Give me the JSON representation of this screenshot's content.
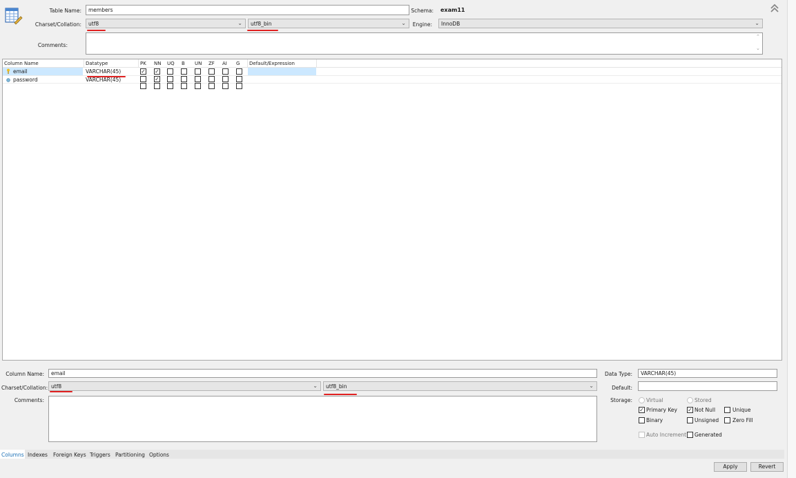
{
  "table": {
    "name_label": "Table Name:",
    "name_value": "members",
    "schema_label": "Schema:",
    "schema_value": "exam11",
    "charset_label": "Charset/Collation:",
    "charset_value": "utf8",
    "collation_value": "utf8_bin",
    "engine_label": "Engine:",
    "engine_value": "InnoDB",
    "comments_label": "Comments:",
    "comments_value": ""
  },
  "grid": {
    "headers": [
      "Column Name",
      "Datatype",
      "PK",
      "NN",
      "UQ",
      "B",
      "UN",
      "ZF",
      "AI",
      "G",
      "Default/Expression"
    ],
    "rows": [
      {
        "icon": "key-icon",
        "name": "email",
        "datatype": "VARCHAR(45)",
        "flags": [
          true,
          true,
          false,
          false,
          false,
          false,
          false,
          false
        ],
        "default": ""
      },
      {
        "icon": "diamond-icon",
        "name": "password",
        "datatype": "VARCHAR(45)",
        "flags": [
          false,
          true,
          false,
          false,
          false,
          false,
          false,
          false
        ],
        "default": ""
      },
      {
        "icon": "",
        "name": "",
        "datatype": "",
        "flags": [
          false,
          false,
          false,
          false,
          false,
          false,
          false,
          false
        ],
        "default": ""
      }
    ]
  },
  "detail": {
    "column_name_label": "Column Name:",
    "column_name_value": "email",
    "charset_label": "Charset/Collation:",
    "charset_value": "utf8",
    "collation_value": "utf8_bin",
    "comments_label": "Comments:",
    "comments_value": "",
    "data_type_label": "Data Type:",
    "data_type_value": "VARCHAR(45)",
    "default_label": "Default:",
    "default_value": "",
    "storage_label": "Storage:",
    "virtual_label": "Virtual",
    "stored_label": "Stored",
    "primary_key_label": "Primary Key",
    "not_null_label": "Not Null",
    "unique_label": "Unique",
    "binary_label": "Binary",
    "unsigned_label": "Unsigned",
    "zero_fill_label": "Zero Fill",
    "auto_increment_label": "Auto Increment",
    "generated_label": "Generated"
  },
  "tabs": [
    "Columns",
    "Indexes",
    "Foreign Keys",
    "Triggers",
    "Partitioning",
    "Options"
  ],
  "buttons": {
    "apply": "Apply",
    "revert": "Revert"
  },
  "colors": {
    "annotation": "#e02020",
    "selection": "#cce8ff",
    "active_tab": "#1a6fb5"
  }
}
